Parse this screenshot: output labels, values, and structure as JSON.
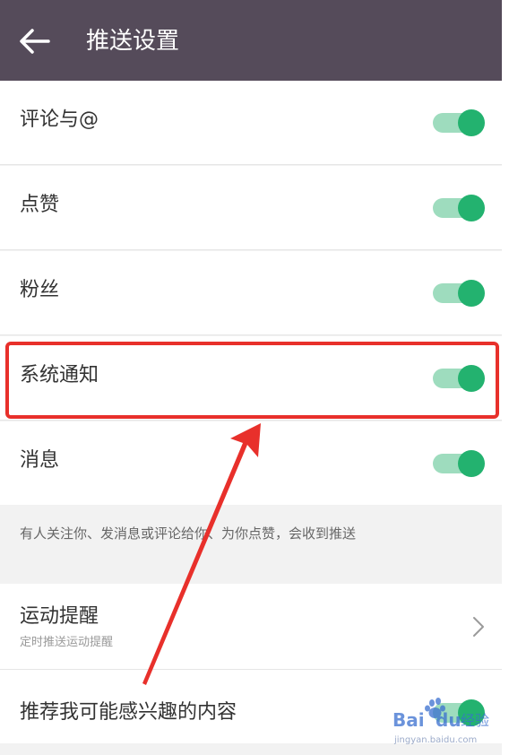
{
  "header": {
    "title": "推送设置",
    "back_icon": "arrow-left-icon"
  },
  "settings": [
    {
      "label": "评论与@",
      "enabled": true
    },
    {
      "label": "点赞",
      "enabled": true
    },
    {
      "label": "粉丝",
      "enabled": true
    },
    {
      "label": "系统通知",
      "enabled": true
    },
    {
      "label": "消息",
      "enabled": true
    }
  ],
  "note": "有人关注你、发消息或评论给你、为你点赞，会收到推送",
  "sport_reminder": {
    "title": "运动提醒",
    "subtitle": "定时推送运动提醒",
    "icon": "chevron-right-icon"
  },
  "recommend": {
    "label": "推荐我可能感兴趣的内容",
    "enabled": true
  },
  "annotation": {
    "highlight_color": "#e8302b"
  },
  "watermark": {
    "brand": "Baidu经验",
    "url": "jingyan.baidu.com"
  },
  "colors": {
    "header_bg": "#554b5a",
    "toggle_on": "#23b26f",
    "toggle_track": "#9edcbe"
  }
}
